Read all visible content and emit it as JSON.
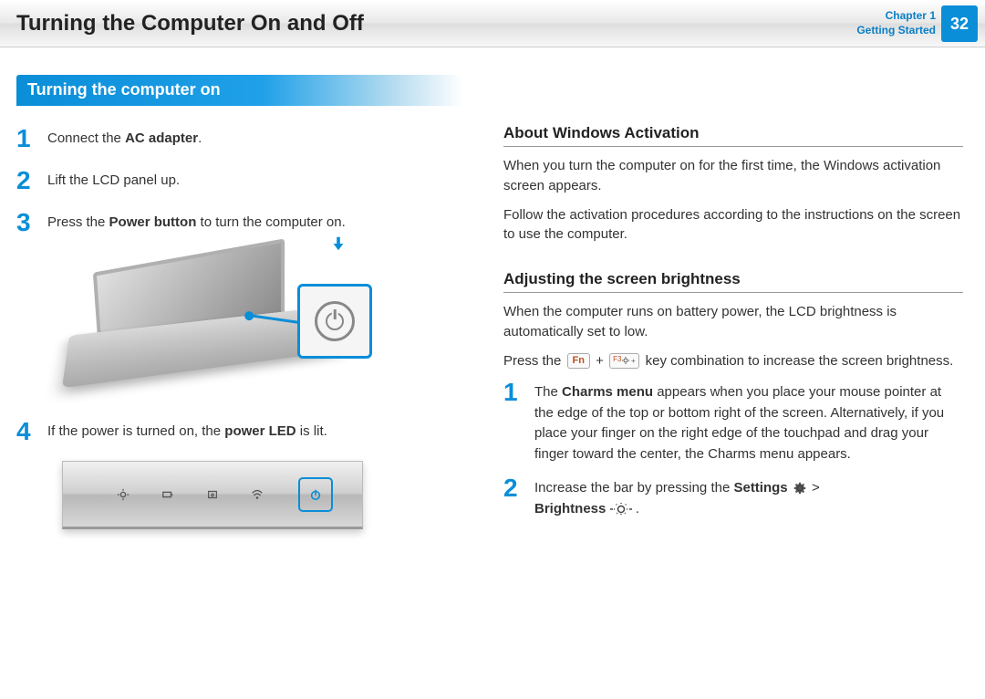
{
  "header": {
    "title": "Turning the Computer On and Off",
    "chapter_line1": "Chapter 1",
    "chapter_line2": "Getting Started",
    "page_number": "32"
  },
  "section_banner": "Turning the computer on",
  "left_steps": [
    {
      "num": "1",
      "pre": "Connect the ",
      "bold": "AC adapter",
      "post": "."
    },
    {
      "num": "2",
      "pre": "Lift the LCD panel up.",
      "bold": "",
      "post": ""
    },
    {
      "num": "3",
      "pre": "Press the ",
      "bold": "Power button",
      "post": " to turn the computer on."
    },
    {
      "num": "4",
      "pre": "If the power is turned on, the ",
      "bold": "power LED",
      "post": " is lit."
    }
  ],
  "right": {
    "activation": {
      "heading": "About Windows Activation",
      "p1": "When you turn the computer on for the first time, the Windows activation screen appears.",
      "p2": "Follow the activation procedures according to the instructions on the screen to use the computer."
    },
    "brightness": {
      "heading": "Adjusting the screen brightness",
      "p1": "When the computer runs on battery power, the LCD brightness is automatically set to low.",
      "p2_pre": "Press the ",
      "key_fn": "Fn",
      "plus": " + ",
      "key_f3_label": "F3",
      "p2_post": " key combination to increase the screen brightness."
    },
    "steps": [
      {
        "num": "1",
        "text_pre": "The ",
        "bold1": "Charms menu",
        "text_post": " appears when you place your mouse pointer at the edge of the top or bottom right of the screen. Alternatively, if you place your finger on the right edge of the touchpad and drag your finger toward the center, the Charms menu appears."
      },
      {
        "num": "2",
        "text_pre": "Increase the bar by pressing the ",
        "bold1": "Settings",
        "gt": " > ",
        "bold2": "Brightness",
        "text_post": " ."
      }
    ]
  }
}
